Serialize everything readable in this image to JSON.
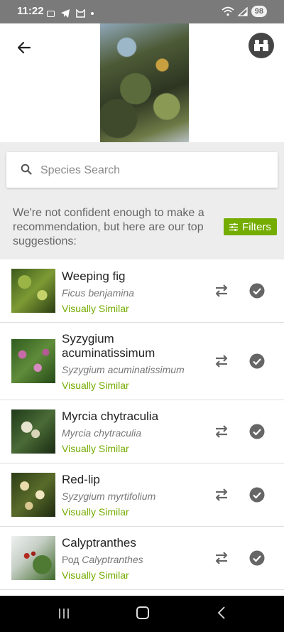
{
  "status_bar": {
    "time": "11:22",
    "battery": "98"
  },
  "search": {
    "placeholder": "Species Search"
  },
  "notice": "We're not confident enough to make a recommendation, but here are our top suggestions:",
  "filters_label": "Filters",
  "results": [
    {
      "name": "Weeping fig",
      "scientific": "Ficus benjamina",
      "tag": "Visually Similar"
    },
    {
      "name": "Syzygium acuminatissimum",
      "scientific": "Syzygium acuminatissimum",
      "tag": "Visually Similar"
    },
    {
      "name": "Myrcia chytraculia",
      "scientific": "Myrcia chytraculia",
      "tag": "Visually Similar"
    },
    {
      "name": "Red-lip",
      "scientific": "Syzygium myrtifolium",
      "tag": "Visually Similar"
    },
    {
      "name": "Calyptranthes",
      "scientific_prefix": "Род",
      "scientific": "Calyptranthes",
      "tag": "Visually Similar"
    }
  ],
  "colors": {
    "accent": "#74ac00",
    "status_bar": "#7a7a7a",
    "panel": "#ededed"
  },
  "icons": [
    "arrow-left-icon",
    "binoculars-icon",
    "search-icon",
    "sliders-icon",
    "swap-icon",
    "check-circle-icon"
  ]
}
